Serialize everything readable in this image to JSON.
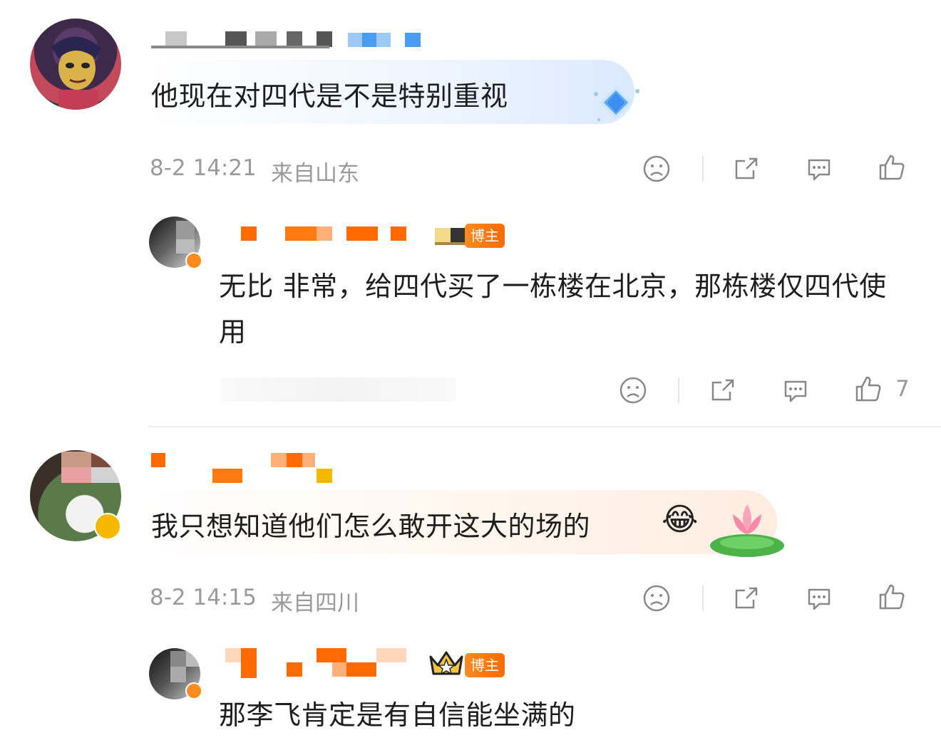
{
  "comments": [
    {
      "text": "他现在对四代是不是特别重视",
      "time": "8-2 14:21",
      "location": "来自山东",
      "reply": {
        "badge": "博主",
        "text": "无比 非常，给四代买了一栋楼在北京，那栋楼仅四代使用",
        "like_count": "7"
      }
    },
    {
      "text": "我只想知道他们怎么敢开这大的场的",
      "emoji": "😂",
      "time": "8-2 14:15",
      "location": "来自四川",
      "reply": {
        "badge": "博主",
        "text": "那李飞肯定是有自信能坐满的"
      }
    }
  ],
  "icons": {
    "dislike": "sad-face-icon",
    "share": "share-icon",
    "comment": "comment-icon",
    "like": "thumbs-up-icon",
    "verified": "verified-v-icon",
    "crown": "crown-icon",
    "diamond": "diamond-decoration-icon",
    "lotus": "lotus-decoration-icon"
  },
  "colors": {
    "accent_orange": "#ff6a00",
    "verified_gold": "#f5b800",
    "meta_gray": "#9a9a9a"
  }
}
